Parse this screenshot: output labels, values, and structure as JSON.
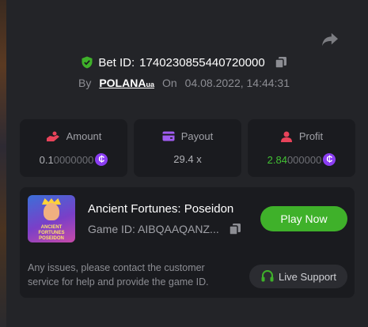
{
  "bet": {
    "id_label": "Bet ID:",
    "id_value": "1740230855440720000",
    "by_label": "By",
    "user": "POLANA",
    "user_suffix": "ua",
    "on_label": "On",
    "datetime": "04.08.2022, 14:44:31"
  },
  "stats": {
    "amount": {
      "label": "Amount",
      "value_main": "0.1",
      "value_dim": "0000000"
    },
    "payout": {
      "label": "Payout",
      "value": "29.4 x"
    },
    "profit": {
      "label": "Profit",
      "value_main": "2.84",
      "value_dim": "000000"
    }
  },
  "currency_glyph": "₵",
  "game": {
    "title": "Ancient Fortunes: Poseidon",
    "thumb_text_1": "ANCIENT",
    "thumb_text_2": "FORTUNES",
    "thumb_text_3": "POSEIDON",
    "id_label": "Game ID:",
    "id_value": "AIBQAAQANZ...",
    "play_label": "Play Now"
  },
  "support": {
    "message": "Any issues, please contact the customer service for help and provide the game ID.",
    "button_label": "Live Support"
  },
  "colors": {
    "accent_green": "#3fb12a",
    "profit_green": "#42c133",
    "coin_purple": "#8b3df2",
    "icon_red": "#e8435a",
    "icon_purple": "#a05cf0"
  },
  "icons": [
    "share-icon",
    "shield-check-icon",
    "copy-icon",
    "hand-coins-icon",
    "wallet-icon",
    "user-icon",
    "coin-icon",
    "headset-icon"
  ]
}
